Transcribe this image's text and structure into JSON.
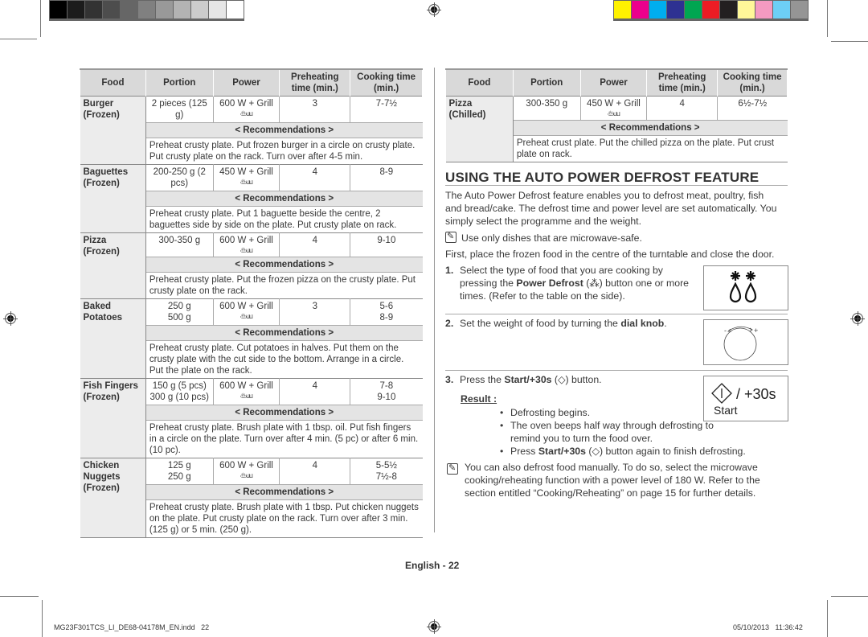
{
  "print_marks": {
    "gray_swatches": [
      "#000000",
      "#1c1c1c",
      "#333333",
      "#4d4d4d",
      "#666666",
      "#808080",
      "#999999",
      "#b3b3b3",
      "#cccccc",
      "#e6e6e6",
      "#ffffff"
    ],
    "color_swatches": [
      "#fff200",
      "#ec008c",
      "#00aeef",
      "#2e3192",
      "#00a651",
      "#ed1c24",
      "#231f20",
      "#fff799",
      "#f49ac1",
      "#6dcff6",
      "#959595"
    ]
  },
  "left_table": {
    "headers": [
      "Food",
      "Portion",
      "Power",
      "Preheating time (min.)",
      "Cooking time (min.)"
    ],
    "recommendations_label": "< Recommendations >",
    "rows": [
      {
        "food": "Burger (Frozen)",
        "portion": "2 pieces (125 g)",
        "power": "600 W + Grill",
        "preheat": "3",
        "cook": "7-7½",
        "rec": "Preheat crusty plate. Put frozen burger in a circle on crusty plate. Put crusty plate on the rack. Turn over after 4-5 min."
      },
      {
        "food": "Baguettes (Frozen)",
        "portion": "200-250 g (2 pcs)",
        "power": "450 W + Grill",
        "preheat": "4",
        "cook": "8-9",
        "rec": "Preheat crusty plate. Put 1 baguette beside the centre, 2 baguettes side by side on the plate. Put crusty plate on rack."
      },
      {
        "food": "Pizza (Frozen)",
        "portion": "300-350 g",
        "power": "600 W + Grill",
        "preheat": "4",
        "cook": "9-10",
        "rec": "Preheat crusty plate. Put the frozen pizza on the crusty plate. Put crusty plate on the rack."
      },
      {
        "food": "Baked Potatoes",
        "portion": "250 g\n500 g",
        "power": "600 W + Grill",
        "preheat": "3",
        "cook": "5-6\n8-9",
        "rec": "Preheat crusty plate. Cut potatoes in halves. Put them on the crusty plate with the cut side to the bottom. Arrange in a circle. Put the plate on the rack."
      },
      {
        "food": "Fish Fingers (Frozen)",
        "portion": "150 g (5 pcs)\n300 g (10 pcs)",
        "power": "600 W + Grill",
        "preheat": "4",
        "cook": "7-8\n9-10",
        "rec": "Preheat crusty plate. Brush plate with 1 tbsp. oil. Put fish fingers in a circle on the plate. Turn over after 4 min. (5 pc) or after 6 min. (10 pc)."
      },
      {
        "food": "Chicken Nuggets (Frozen)",
        "portion": "125 g\n250 g",
        "power": "600 W + Grill",
        "preheat": "4",
        "cook": "5-5½\n7½-8",
        "rec": "Preheat crusty plate. Brush plate with 1 tbsp. Put chicken nuggets on the plate. Put crusty plate on the rack. Turn over after 3 min. (125 g) or 5 min. (250 g)."
      }
    ],
    "grill_symbol": "ఆ꒐"
  },
  "right_table": {
    "headers": [
      "Food",
      "Portion",
      "Power",
      "Preheating time (min.)",
      "Cooking time (min.)"
    ],
    "recommendations_label": "< Recommendations >",
    "rows": [
      {
        "food": "Pizza (Chilled)",
        "portion": "300-350 g",
        "power": "450 W + Grill",
        "preheat": "4",
        "cook": "6½-7½",
        "rec": "Preheat crust plate. Put the chilled pizza on the plate. Put crust plate on rack."
      }
    ]
  },
  "section": {
    "title": "USING THE AUTO POWER DEFROST FEATURE",
    "intro": "The Auto Power Defrost feature enables you to defrost meat, poultry, fish and bread/cake. The defrost time and power level are set automatically. You simply select the programme and the weight.",
    "note1": "Use only dishes that are microwave-safe.",
    "first": "First, place the frozen food in the centre of the turntable and close the door.",
    "step1": {
      "num": "1.",
      "pre": "Select the type of food that you are cooking by pressing the ",
      "bold": "Power Defrost",
      "post": " (⁂) button one or more times. (Refer to the table on the side)."
    },
    "step2": {
      "num": "2.",
      "pre": "Set the weight of food by turning the ",
      "bold": "dial knob",
      "post": "."
    },
    "step3": {
      "num": "3.",
      "pre": "Press the ",
      "bold": "Start/+30s",
      "post": " (◇) button."
    },
    "result_label": "Result :",
    "bullets": [
      {
        "text": "Defrosting begins."
      },
      {
        "text": "The oven beeps half way through defrosting to remind you to turn the food over."
      },
      {
        "pre": "Press ",
        "bold": "Start/+30s",
        "post": " (◇) button again to finish defrosting."
      }
    ],
    "note2": "You can also defrost food manually. To do so, select the microwave cooking/reheating function with a power level of 180 W. Refer to the section entitled “Cooking/Reheating” on page 15 for further details.",
    "fig_dial": {
      "minus": "-",
      "plus": "+"
    },
    "fig_start": {
      "symbol_text": "/ +30s",
      "label": "Start"
    }
  },
  "page_footer": {
    "page_label": "English - 22",
    "file_name": "MG23F301TCS_LI_DE68-04178M_EN.indd   22",
    "timestamp": "05/10/2013   11:36:42"
  }
}
